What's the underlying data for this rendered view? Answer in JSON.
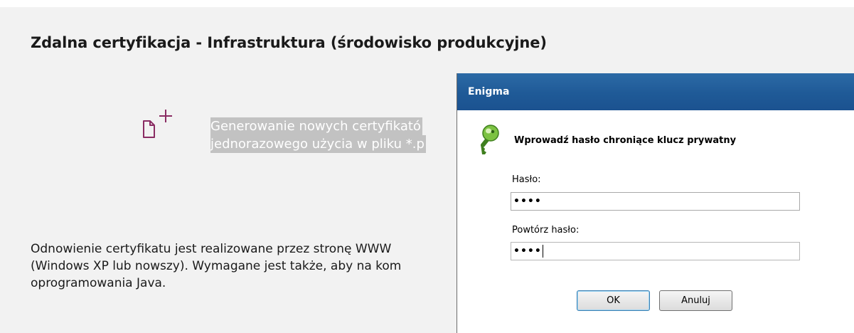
{
  "page": {
    "title": "Zdalna certyfikacja - Infrastruktura (środowisko produkcyjne)",
    "generate": {
      "line1": "Generowanie nowych certyfikató",
      "line2": "jednorazowego użycia w pliku *.p"
    },
    "info": {
      "line1": "Odnowienie certyfikatu jest realizowane przez stronę WWW",
      "line2": "(Windows XP lub nowszy). Wymagane jest także, aby na kom",
      "line3": "oprogramowania Java."
    }
  },
  "dialog": {
    "title": "Enigma",
    "prompt": "Wprowadź hasło chroniące klucz prywatny",
    "password_label": "Hasło:",
    "password_value": "••••",
    "repeat_label": "Powtórz hasło:",
    "repeat_value": "••••",
    "ok_label": "OK",
    "cancel_label": "Anuluj"
  },
  "icons": {
    "certificate": "new-document-icon",
    "key": "key-icon"
  },
  "colors": {
    "accent": "#8a2c63",
    "key_green": "#7cc242",
    "titlebar": "#1f5a97",
    "selection": "#c2c2c2"
  }
}
